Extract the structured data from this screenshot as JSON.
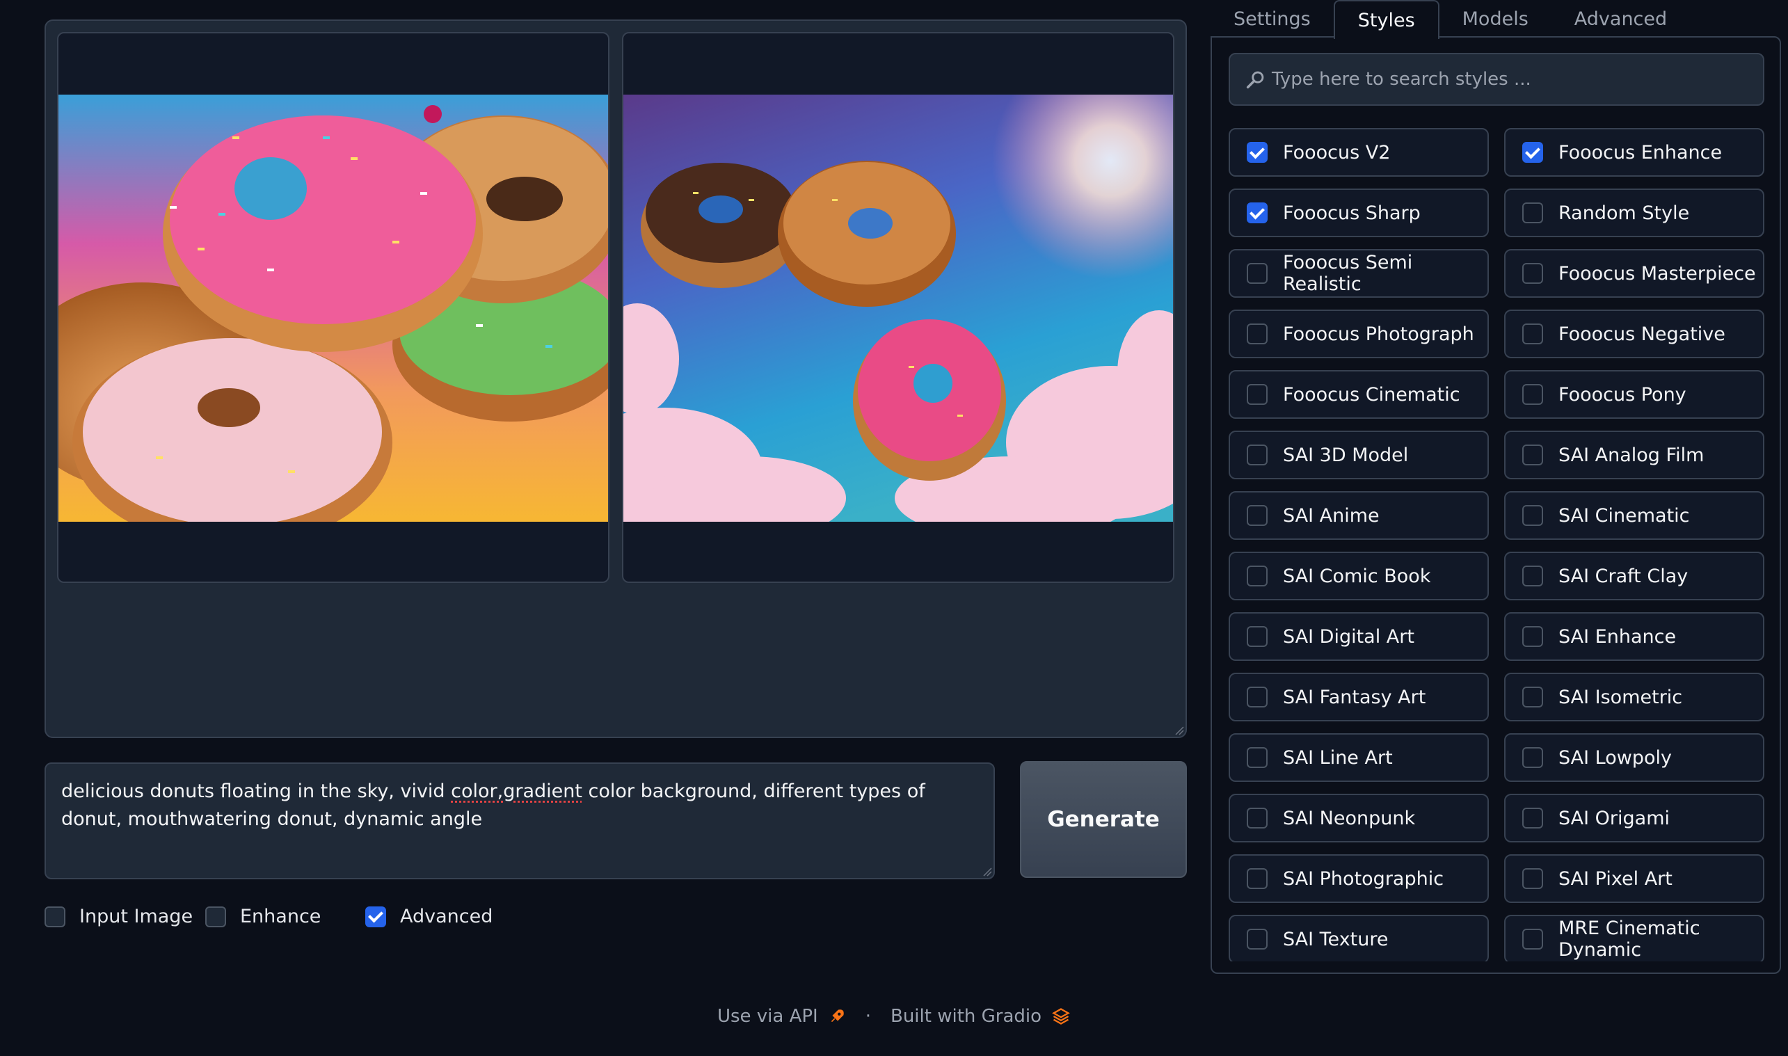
{
  "gallery": {
    "images": [
      "Generated image 1",
      "Generated image 2"
    ]
  },
  "prompt": {
    "text_before": "delicious donuts floating in the sky, vivid ",
    "text_spell": "color,gradient",
    "text_after": " color background, different types of donut, mouthwatering donut, dynamic angle"
  },
  "generate_label": "Generate",
  "options": [
    {
      "label": "Input Image",
      "checked": false
    },
    {
      "label": "Enhance",
      "checked": false
    },
    {
      "label": "Advanced",
      "checked": true
    }
  ],
  "footer": {
    "api_label": "Use via API",
    "built_label": "Built with Gradio",
    "separator": "·"
  },
  "tabs": [
    {
      "label": "Settings",
      "active": false
    },
    {
      "label": "Styles",
      "active": true
    },
    {
      "label": "Models",
      "active": false
    },
    {
      "label": "Advanced",
      "active": false
    }
  ],
  "search": {
    "placeholder": "Type here to search styles ..."
  },
  "styles": [
    {
      "label": "Fooocus V2",
      "checked": true
    },
    {
      "label": "Fooocus Enhance",
      "checked": true
    },
    {
      "label": "Fooocus Sharp",
      "checked": true
    },
    {
      "label": "Random Style",
      "checked": false
    },
    {
      "label": "Fooocus Semi Realistic",
      "checked": false
    },
    {
      "label": "Fooocus Masterpiece",
      "checked": false
    },
    {
      "label": "Fooocus Photograph",
      "checked": false
    },
    {
      "label": "Fooocus Negative",
      "checked": false
    },
    {
      "label": "Fooocus Cinematic",
      "checked": false
    },
    {
      "label": "Fooocus Pony",
      "checked": false
    },
    {
      "label": "SAI 3D Model",
      "checked": false
    },
    {
      "label": "SAI Analog Film",
      "checked": false
    },
    {
      "label": "SAI Anime",
      "checked": false
    },
    {
      "label": "SAI Cinematic",
      "checked": false
    },
    {
      "label": "SAI Comic Book",
      "checked": false
    },
    {
      "label": "SAI Craft Clay",
      "checked": false
    },
    {
      "label": "SAI Digital Art",
      "checked": false
    },
    {
      "label": "SAI Enhance",
      "checked": false
    },
    {
      "label": "SAI Fantasy Art",
      "checked": false
    },
    {
      "label": "SAI Isometric",
      "checked": false
    },
    {
      "label": "SAI Line Art",
      "checked": false
    },
    {
      "label": "SAI Lowpoly",
      "checked": false
    },
    {
      "label": "SAI Neonpunk",
      "checked": false
    },
    {
      "label": "SAI Origami",
      "checked": false
    },
    {
      "label": "SAI Photographic",
      "checked": false
    },
    {
      "label": "SAI Pixel Art",
      "checked": false
    },
    {
      "label": "SAI Texture",
      "checked": false
    },
    {
      "label": "MRE Cinematic Dynamic",
      "checked": false
    }
  ],
  "colors": {
    "accent": "#2563eb",
    "bg": "#0b0f19",
    "panel": "#1f2937"
  }
}
